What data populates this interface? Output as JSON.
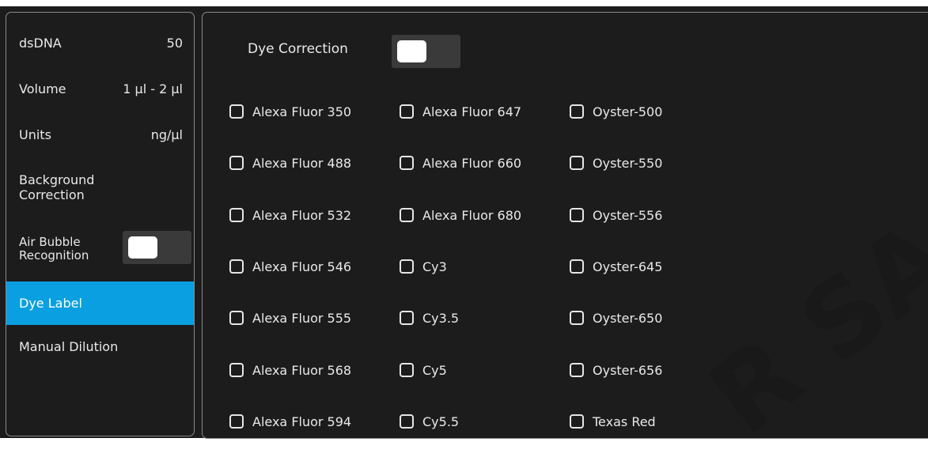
{
  "sidebar": {
    "dsdna": {
      "label": "dsDNA",
      "value": "50"
    },
    "volume": {
      "label": "Volume",
      "value": "1 µl - 2 µl"
    },
    "units": {
      "label": "Units",
      "value": "ng/µl"
    },
    "background_correction": {
      "line1": "Background",
      "line2": "Correction"
    },
    "air_bubble": {
      "line1": "Air Bubble",
      "line2": "Recognition",
      "toggle_on": false
    },
    "dye_label": {
      "label": "Dye Label",
      "selected": true
    },
    "manual_dilution": {
      "label": "Manual Dilution"
    }
  },
  "dye_correction": {
    "label": "Dye Correction",
    "toggle_on": false
  },
  "dyes": {
    "col1": [
      "Alexa Fluor 350",
      "Alexa Fluor 488",
      "Alexa Fluor 532",
      "Alexa Fluor 546",
      "Alexa Fluor 555",
      "Alexa Fluor 568",
      "Alexa Fluor 594"
    ],
    "col2": [
      "Alexa Fluor 647",
      "Alexa Fluor 660",
      "Alexa Fluor 680",
      "Cy3",
      "Cy3.5",
      "Cy5",
      "Cy5.5"
    ],
    "col3": [
      "Oyster-500",
      "Oyster-550",
      "Oyster-556",
      "Oyster-645",
      "Oyster-650",
      "Oyster-656",
      "Texas Red"
    ]
  },
  "colors": {
    "accent": "#0a9fe0",
    "background": "#1c1c1c",
    "text": "#e9e9e9"
  }
}
